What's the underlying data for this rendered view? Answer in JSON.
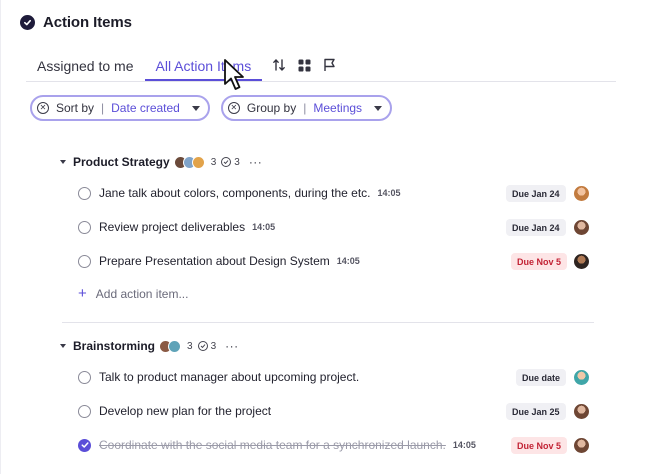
{
  "header": {
    "title": "Action Items",
    "icon": "check-circle-icon"
  },
  "tabs": [
    {
      "label": "Assigned to me",
      "active": false
    },
    {
      "label": "All Action Items",
      "active": true
    }
  ],
  "tools": [
    "sort-arrows-icon",
    "grid-icon",
    "flag-icon"
  ],
  "filters": {
    "sort": {
      "label": "Sort by",
      "sep": "|",
      "value": "Date created"
    },
    "group": {
      "label": "Group by",
      "sep": "|",
      "value": "Meetings"
    }
  },
  "groups": [
    {
      "title": "Product Strategy",
      "count_left": "3",
      "count_done": "3",
      "more": "···",
      "items": [
        {
          "text": "Jane talk about colors, components, during the etc.",
          "time": "14:05",
          "due": "Due Jan 24",
          "due_style": "grey",
          "done": false
        },
        {
          "text": "Review project deliverables",
          "time": "14:05",
          "due": "Due Jan 24",
          "due_style": "grey",
          "done": false
        },
        {
          "text": "Prepare Presentation about Design System",
          "time": "14:05",
          "due": "Due Nov 5",
          "due_style": "red",
          "done": false
        }
      ],
      "add_label": "Add action item..."
    },
    {
      "title": "Brainstorming",
      "count_left": "3",
      "count_done": "3",
      "more": "···",
      "items": [
        {
          "text": "Talk to product manager about upcoming project.",
          "time": "",
          "due": "Due date",
          "due_style": "grey",
          "done": false
        },
        {
          "text": "Develop new plan for the project",
          "time": "",
          "due": "Due Jan 25",
          "due_style": "grey",
          "done": false
        },
        {
          "text": "Coordinate with the social media team for a synchronized launch.",
          "time": "14:05",
          "due": "Due Nov 5",
          "due_style": "red",
          "done": true
        }
      ]
    }
  ],
  "colors": {
    "accent": "#5b4ed8",
    "due_red_bg": "#fde5e6",
    "due_red_text": "#c22335",
    "chip_border": "#a9a2ec"
  }
}
